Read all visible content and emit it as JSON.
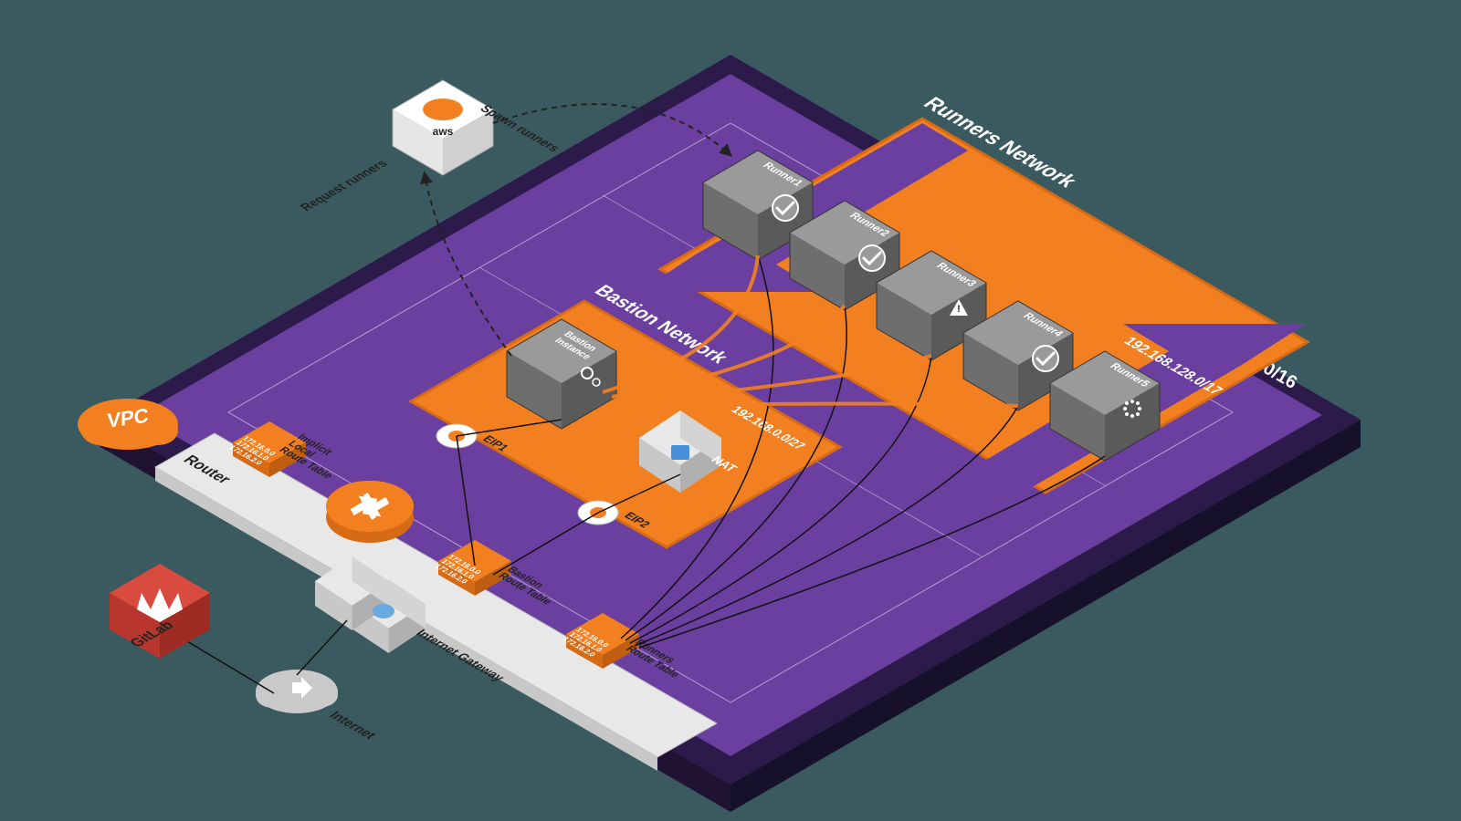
{
  "vpc": {
    "label": "VPC",
    "cidr": "192.168.0.0/16"
  },
  "bastion_network": {
    "label": "Bastion Network",
    "cidr": "192.168.0.0/27",
    "instance_label": "Bastion\nInstance"
  },
  "runners_network": {
    "label": "Runners Network",
    "cidr": "192.168.128.0/17",
    "runners": [
      {
        "name": "Runner1",
        "state": "ok"
      },
      {
        "name": "Runner2",
        "state": "ok"
      },
      {
        "name": "Runner3",
        "state": "warn"
      },
      {
        "name": "Runner4",
        "state": "ok"
      },
      {
        "name": "Runner5",
        "state": "loading"
      }
    ]
  },
  "eip1": "EIP1",
  "eip2": "EIP2",
  "nat": "NAT",
  "router": {
    "label": "Router",
    "implicit": "Implicit\nLocal\nRoute Table",
    "bastion": "Bastion\nRoute Table",
    "runners": "Runners\nRoute Table",
    "rows": [
      "172.16.0.0",
      "172.16.1.0",
      "172.16.2.0"
    ]
  },
  "igw": "Internet Gateway",
  "internet": "Internet",
  "gitlab": "GitLab",
  "aws": {
    "label": "Spawn runners",
    "request": "Request runners"
  },
  "colors": {
    "orange": "#f38020",
    "purple": "#6b3fa0",
    "darkpurple": "#2c1a4a",
    "gray": "#7d7d7d",
    "lightgray": "#dcdcdc",
    "red": "#c8352f",
    "white": "#fff"
  }
}
